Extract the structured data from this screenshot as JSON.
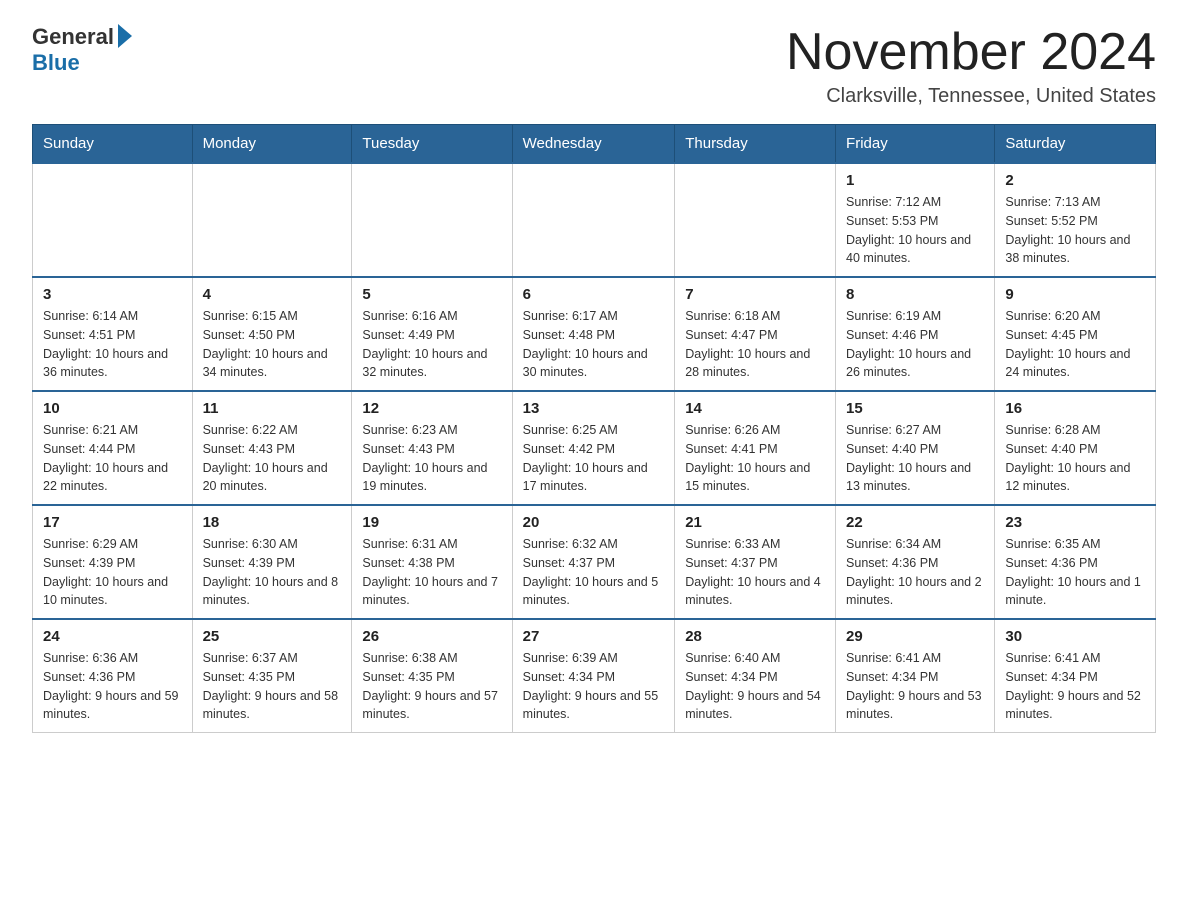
{
  "header": {
    "logo_text": "General",
    "logo_blue": "Blue",
    "month_title": "November 2024",
    "location": "Clarksville, Tennessee, United States"
  },
  "days_of_week": [
    "Sunday",
    "Monday",
    "Tuesday",
    "Wednesday",
    "Thursday",
    "Friday",
    "Saturday"
  ],
  "weeks": [
    [
      {
        "day": "",
        "info": ""
      },
      {
        "day": "",
        "info": ""
      },
      {
        "day": "",
        "info": ""
      },
      {
        "day": "",
        "info": ""
      },
      {
        "day": "",
        "info": ""
      },
      {
        "day": "1",
        "info": "Sunrise: 7:12 AM\nSunset: 5:53 PM\nDaylight: 10 hours and 40 minutes."
      },
      {
        "day": "2",
        "info": "Sunrise: 7:13 AM\nSunset: 5:52 PM\nDaylight: 10 hours and 38 minutes."
      }
    ],
    [
      {
        "day": "3",
        "info": "Sunrise: 6:14 AM\nSunset: 4:51 PM\nDaylight: 10 hours and 36 minutes."
      },
      {
        "day": "4",
        "info": "Sunrise: 6:15 AM\nSunset: 4:50 PM\nDaylight: 10 hours and 34 minutes."
      },
      {
        "day": "5",
        "info": "Sunrise: 6:16 AM\nSunset: 4:49 PM\nDaylight: 10 hours and 32 minutes."
      },
      {
        "day": "6",
        "info": "Sunrise: 6:17 AM\nSunset: 4:48 PM\nDaylight: 10 hours and 30 minutes."
      },
      {
        "day": "7",
        "info": "Sunrise: 6:18 AM\nSunset: 4:47 PM\nDaylight: 10 hours and 28 minutes."
      },
      {
        "day": "8",
        "info": "Sunrise: 6:19 AM\nSunset: 4:46 PM\nDaylight: 10 hours and 26 minutes."
      },
      {
        "day": "9",
        "info": "Sunrise: 6:20 AM\nSunset: 4:45 PM\nDaylight: 10 hours and 24 minutes."
      }
    ],
    [
      {
        "day": "10",
        "info": "Sunrise: 6:21 AM\nSunset: 4:44 PM\nDaylight: 10 hours and 22 minutes."
      },
      {
        "day": "11",
        "info": "Sunrise: 6:22 AM\nSunset: 4:43 PM\nDaylight: 10 hours and 20 minutes."
      },
      {
        "day": "12",
        "info": "Sunrise: 6:23 AM\nSunset: 4:43 PM\nDaylight: 10 hours and 19 minutes."
      },
      {
        "day": "13",
        "info": "Sunrise: 6:25 AM\nSunset: 4:42 PM\nDaylight: 10 hours and 17 minutes."
      },
      {
        "day": "14",
        "info": "Sunrise: 6:26 AM\nSunset: 4:41 PM\nDaylight: 10 hours and 15 minutes."
      },
      {
        "day": "15",
        "info": "Sunrise: 6:27 AM\nSunset: 4:40 PM\nDaylight: 10 hours and 13 minutes."
      },
      {
        "day": "16",
        "info": "Sunrise: 6:28 AM\nSunset: 4:40 PM\nDaylight: 10 hours and 12 minutes."
      }
    ],
    [
      {
        "day": "17",
        "info": "Sunrise: 6:29 AM\nSunset: 4:39 PM\nDaylight: 10 hours and 10 minutes."
      },
      {
        "day": "18",
        "info": "Sunrise: 6:30 AM\nSunset: 4:39 PM\nDaylight: 10 hours and 8 minutes."
      },
      {
        "day": "19",
        "info": "Sunrise: 6:31 AM\nSunset: 4:38 PM\nDaylight: 10 hours and 7 minutes."
      },
      {
        "day": "20",
        "info": "Sunrise: 6:32 AM\nSunset: 4:37 PM\nDaylight: 10 hours and 5 minutes."
      },
      {
        "day": "21",
        "info": "Sunrise: 6:33 AM\nSunset: 4:37 PM\nDaylight: 10 hours and 4 minutes."
      },
      {
        "day": "22",
        "info": "Sunrise: 6:34 AM\nSunset: 4:36 PM\nDaylight: 10 hours and 2 minutes."
      },
      {
        "day": "23",
        "info": "Sunrise: 6:35 AM\nSunset: 4:36 PM\nDaylight: 10 hours and 1 minute."
      }
    ],
    [
      {
        "day": "24",
        "info": "Sunrise: 6:36 AM\nSunset: 4:36 PM\nDaylight: 9 hours and 59 minutes."
      },
      {
        "day": "25",
        "info": "Sunrise: 6:37 AM\nSunset: 4:35 PM\nDaylight: 9 hours and 58 minutes."
      },
      {
        "day": "26",
        "info": "Sunrise: 6:38 AM\nSunset: 4:35 PM\nDaylight: 9 hours and 57 minutes."
      },
      {
        "day": "27",
        "info": "Sunrise: 6:39 AM\nSunset: 4:34 PM\nDaylight: 9 hours and 55 minutes."
      },
      {
        "day": "28",
        "info": "Sunrise: 6:40 AM\nSunset: 4:34 PM\nDaylight: 9 hours and 54 minutes."
      },
      {
        "day": "29",
        "info": "Sunrise: 6:41 AM\nSunset: 4:34 PM\nDaylight: 9 hours and 53 minutes."
      },
      {
        "day": "30",
        "info": "Sunrise: 6:41 AM\nSunset: 4:34 PM\nDaylight: 9 hours and 52 minutes."
      }
    ]
  ]
}
